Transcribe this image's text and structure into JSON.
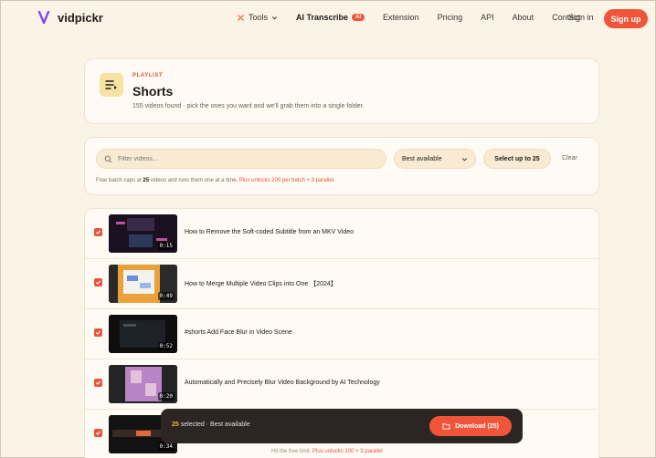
{
  "brand": {
    "name": "vidpickr",
    "accent": "#f0553a"
  },
  "nav": {
    "tools": "Tools",
    "ai_transcribe": "AI Transcribe",
    "ai_badge": "AI",
    "extension": "Extension",
    "pricing": "Pricing",
    "api": "API",
    "about": "About",
    "contact": "Contact",
    "signin": "Sign in",
    "signup": "Sign up"
  },
  "playlist": {
    "kicker": "PLAYLIST",
    "title": "Shorts",
    "description": "155 videos found · pick the ones you want and we'll grab them into a single folder."
  },
  "filter": {
    "search_placeholder": "Filter videos...",
    "quality": "Best available",
    "select_up_to": "Select up to 25",
    "clear": "Clear",
    "caps_prefix": "Free batch caps at",
    "caps_count": "25",
    "caps_suffix": "videos and runs them one at a time.",
    "caps_plus": "Plus unlocks 200 per batch + 3 parallel."
  },
  "videos": [
    {
      "title": "How to Remove the Soft-coded Subtitle from an MKV Video",
      "duration": "0:15",
      "checked": true
    },
    {
      "title": "How to Merge Multiple Video Clips into One 【2024】",
      "duration": "0:49",
      "checked": true
    },
    {
      "title": "#shorts Add Face Blur in Video Scene",
      "duration": "0:52",
      "checked": true
    },
    {
      "title": "Automatically and Precisely Blur Video Background by AI Technology",
      "duration": "0:20",
      "checked": true
    },
    {
      "title": "",
      "duration": "0:34",
      "checked": true
    }
  ],
  "selection": {
    "count": "25",
    "text": "selected · Best available",
    "download": "Download (25)"
  },
  "hint": {
    "prefix": "Hit the free limit.",
    "plus": "Plus unlocks 200 + 3 parallel"
  }
}
